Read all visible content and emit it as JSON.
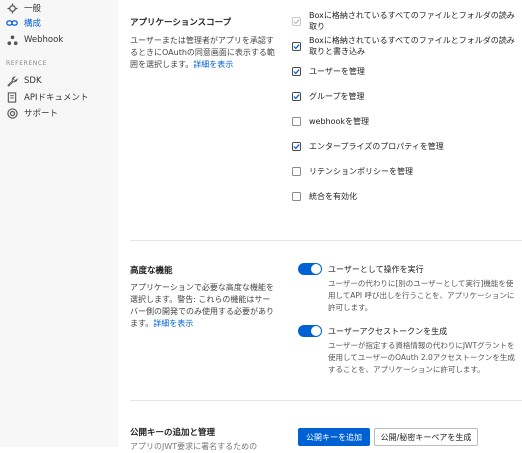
{
  "sidebar": {
    "items": [
      {
        "label": "一般",
        "icon": "settings-icon"
      },
      {
        "label": "構成",
        "icon": "chain-link-icon",
        "active": true
      },
      {
        "label": "Webhook",
        "icon": "webhook-icon"
      }
    ],
    "reference_label": "REFERENCE",
    "ref_items": [
      {
        "label": "SDK",
        "icon": "wrench-icon"
      },
      {
        "label": "APIドキュメント",
        "icon": "document-icon"
      },
      {
        "label": "サポート",
        "icon": "support-icon"
      }
    ]
  },
  "scopes": {
    "title": "アプリケーションスコープ",
    "description": "ユーザーまたは管理者がアプリを承認するときにOAuthの同意画面に表示する範囲を選択します。",
    "link": "詳細を表示",
    "items": [
      {
        "label": "Boxに格納されているすべてのファイルとフォルダの読み取り",
        "checked": true,
        "disabled": true
      },
      {
        "label": "Boxに格納されているすべてのファイルとフォルダの読み取りと書き込み",
        "checked": true
      },
      {
        "label": "ユーザーを管理",
        "checked": true
      },
      {
        "label": "グループを管理",
        "checked": true
      },
      {
        "label": "webhookを管理",
        "checked": false
      },
      {
        "label": "エンタープライズのプロパティを管理",
        "checked": true
      },
      {
        "label": "リテンションポリシーを管理",
        "checked": false
      },
      {
        "label": "統合を有効化",
        "checked": false
      }
    ]
  },
  "advanced": {
    "title": "高度な機能",
    "description": "アプリケーションで必要な高度な機能を選択します。警告: これらの機能はサーバー側の開発でのみ使用する必要があります。",
    "link": "詳細を表示",
    "features": [
      {
        "label": "ユーザーとして操作を実行",
        "enabled": true,
        "description": "ユーザーの代わりに[別のユーザーとして実行]機能を使用してAPI 呼び出しを行うことを、アプリケーションに許可します。"
      },
      {
        "label": "ユーザーアクセストークンを生成",
        "enabled": true,
        "description": "ユーザーが指定する資格情報の代わりにJWTグラントを使用してユーザーのOAuth 2.0アクセストークンを生成することを、アプリケーションに許可します。"
      }
    ]
  },
  "keys": {
    "title": "公開キーの追加と管理",
    "description_fragment": "アプリのJWT要求に署名するための",
    "add_button": "公開キーを追加",
    "generate_button": "公開/秘密キーペアを生成"
  },
  "colors": {
    "accent": "#0061d5",
    "sidebar_bg": "#f7f7f7"
  }
}
